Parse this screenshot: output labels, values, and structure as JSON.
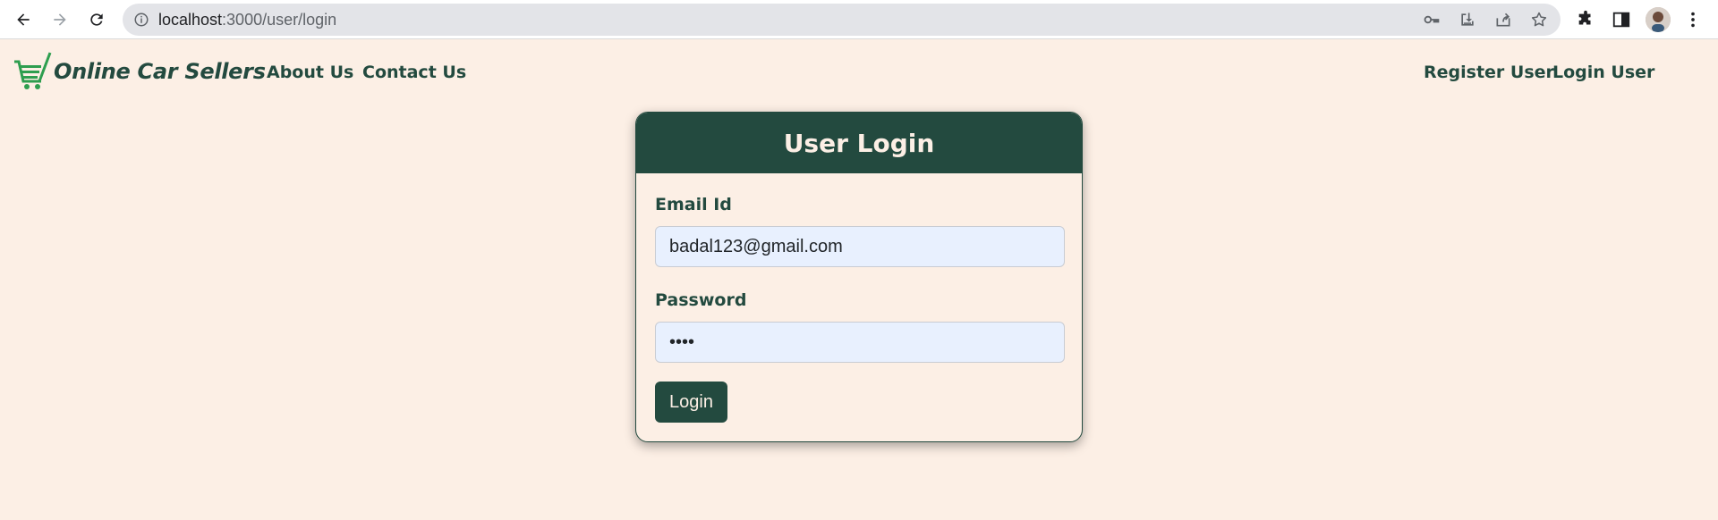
{
  "browser": {
    "url_host": "localhost",
    "url_rest": ":3000/user/login"
  },
  "site": {
    "brand_name": "Online Car Sellers",
    "nav_links": [
      "About Us",
      "Contact Us"
    ],
    "auth_links": [
      "Register User",
      "Login User"
    ]
  },
  "login_card": {
    "title": "User Login",
    "email_label": "Email Id",
    "email_value": "badal123@gmail.com",
    "password_label": "Password",
    "password_value": "••••",
    "submit_label": "Login"
  },
  "colors": {
    "primary": "#234a3f",
    "background": "#fcefe5",
    "input_bg": "#e8f0fe",
    "logo_green": "#2e9e4f"
  }
}
